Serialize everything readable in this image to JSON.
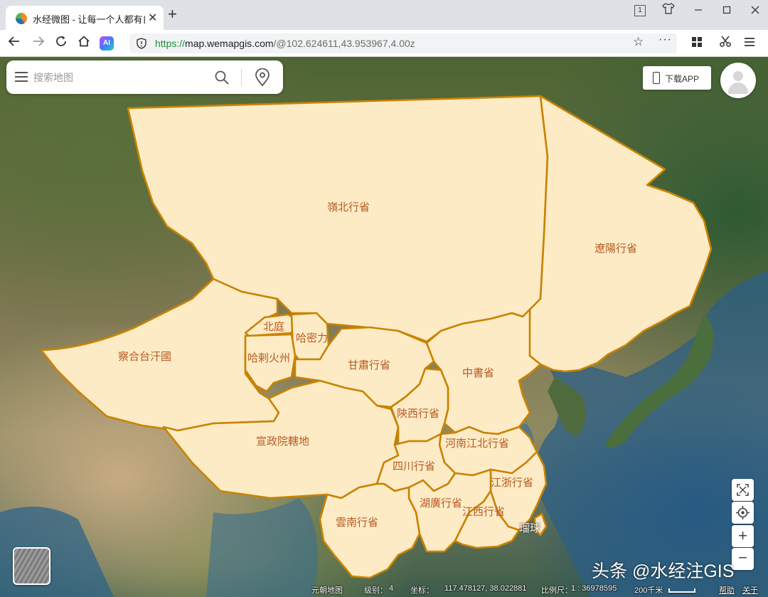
{
  "browser": {
    "tab_title": "水经微图 - 让每一个人都有自",
    "tab_close_glyph": "✕",
    "new_tab_glyph": "+",
    "tabs_count_badge": "1",
    "url_scheme": "https://",
    "url_host": "map.wemapgis.com",
    "url_path": "/@102.624611,43.953967,4.00z",
    "ai_badge": "AI"
  },
  "search": {
    "placeholder": "搜索地图"
  },
  "header": {
    "download_app_label": "下载APP"
  },
  "map": {
    "title": "元朝地图",
    "regions": [
      "嶺北行省",
      "遼陽行省",
      "察合台汗國",
      "北庭",
      "哈密力",
      "哈剌火州",
      "甘肅行省",
      "中書省",
      "宣政院轄地",
      "陝西行省",
      "河南江北行省",
      "四川行省",
      "江浙行省",
      "湖廣行省",
      "雲南行省",
      "江西行省",
      "瑠球"
    ],
    "colors": {
      "region_fill": "#fdebc6",
      "region_border": "#c98300",
      "label": "#b85a22"
    }
  },
  "controls": {
    "zoom_in": "+",
    "zoom_out": "−"
  },
  "status": {
    "map_name": "元朝地图",
    "level_label": "级别：",
    "level": "4",
    "coord_label": "坐标：",
    "coord": "117.478127, 38.022881",
    "scale_label": "比例尺：",
    "scale": "1 : 36978595",
    "scalebar_label": "200千米",
    "help": "帮助",
    "about": "关于"
  },
  "watermark": "头条 @水经注GIS"
}
